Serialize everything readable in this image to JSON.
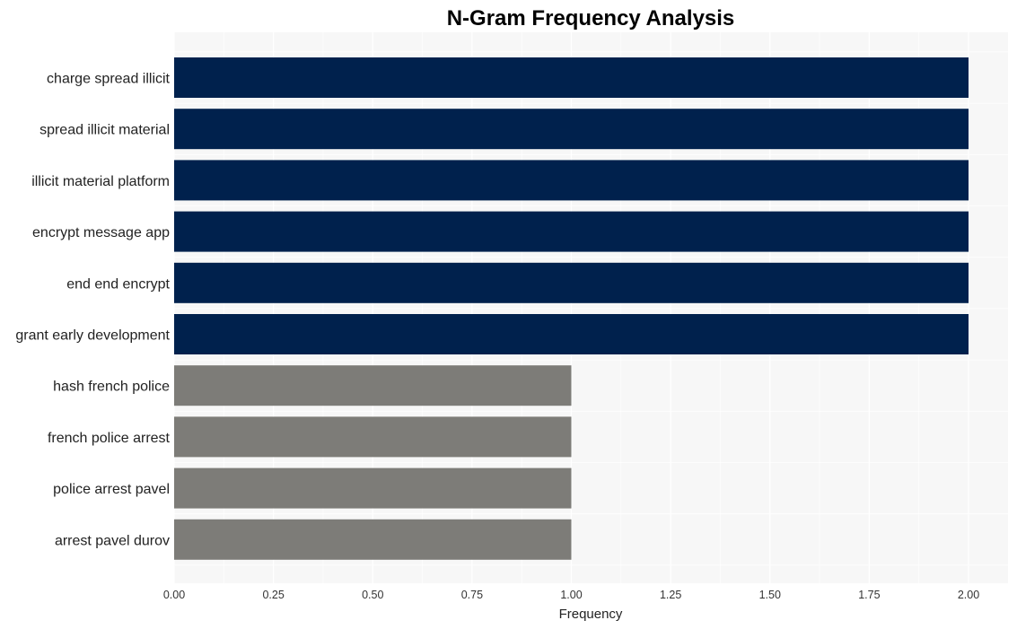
{
  "chart_data": {
    "type": "bar",
    "orientation": "horizontal",
    "title": "N-Gram Frequency Analysis",
    "xlabel": "Frequency",
    "ylabel": "",
    "xlim": [
      0,
      2.1
    ],
    "xticks": [
      0.0,
      0.25,
      0.5,
      0.75,
      1.0,
      1.25,
      1.5,
      1.75,
      2.0
    ],
    "xtick_labels": [
      "0.00",
      "0.25",
      "0.50",
      "0.75",
      "1.00",
      "1.25",
      "1.50",
      "1.75",
      "2.00"
    ],
    "grid": true,
    "categories": [
      "charge spread illicit",
      "spread illicit material",
      "illicit material platform",
      "encrypt message app",
      "end end encrypt",
      "grant early development",
      "hash french police",
      "french police arrest",
      "police arrest pavel",
      "arrest pavel durov"
    ],
    "values": [
      2,
      2,
      2,
      2,
      2,
      2,
      1,
      1,
      1,
      1
    ],
    "colors": {
      "high": "#00214d",
      "low": "#7d7c78",
      "plot_background": "#f7f7f7",
      "grid": "#ffffff"
    }
  }
}
